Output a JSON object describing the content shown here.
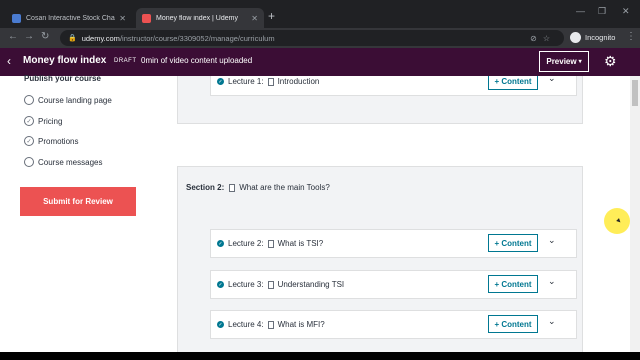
{
  "browser": {
    "tabs": [
      {
        "title": "Cosan Interactive Stock Chart (CZZ)",
        "active": false,
        "favicon_color": "#4a7bd0"
      },
      {
        "title": "Money flow index | Udemy",
        "active": true,
        "favicon_color": "#ec5252"
      }
    ],
    "url_host": "udemy.com",
    "url_path": "/instructor/course/3309052/manage/curriculum",
    "profile_label": "Incognito"
  },
  "header": {
    "course_title": "Money flow index",
    "status_badge": "DRAFT",
    "upload_status": "0min of video content uploaded",
    "preview_label": "Preview"
  },
  "sidebar": {
    "heading": "Publish your course",
    "items": [
      {
        "label": "Course landing page",
        "checked": false
      },
      {
        "label": "Pricing",
        "checked": true
      },
      {
        "label": "Promotions",
        "checked": true
      },
      {
        "label": "Course messages",
        "checked": false
      }
    ],
    "submit_label": "Submit for Review"
  },
  "curriculum": {
    "section_prev_lecture": {
      "number": "Lecture 1:",
      "title": "Introduction",
      "button": "+ Content"
    },
    "section2": {
      "label": "Section 2:",
      "title": "What are the main Tools?",
      "lectures": [
        {
          "number": "Lecture 2:",
          "title": "What is TSI?",
          "button": "+ Content"
        },
        {
          "number": "Lecture 3:",
          "title": "Understanding TSI",
          "button": "+ Content"
        },
        {
          "number": "Lecture 4:",
          "title": "What is MFI?",
          "button": "+ Content"
        }
      ]
    }
  },
  "colors": {
    "header_bg": "#3b0d35",
    "submit_bg": "#ec5252",
    "accent": "#007791"
  }
}
